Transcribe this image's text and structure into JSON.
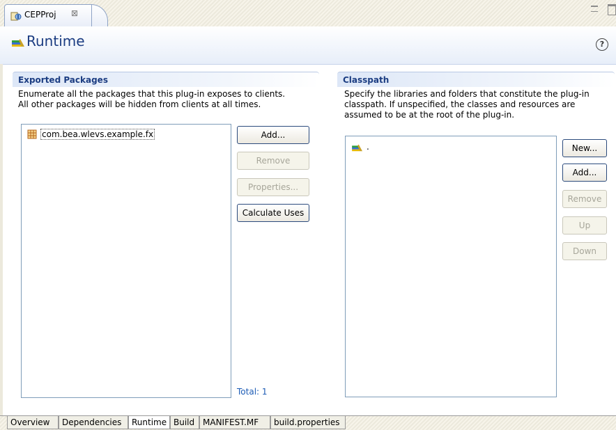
{
  "editor_tab": {
    "title": "CEPProj",
    "close_glyph": "⊠"
  },
  "header": {
    "title": "Runtime",
    "help_glyph": "?",
    "icon": "runtime-books-icon"
  },
  "exported_packages": {
    "title": "Exported Packages",
    "description_line1": "Enumerate all the packages that this plug-in exposes to clients.",
    "description_line2": "All other packages will be hidden from clients at all times.",
    "items": [
      "com.bea.wlevs.example.fx"
    ],
    "buttons": {
      "add": "Add...",
      "remove": "Remove",
      "properties": "Properties...",
      "calculate_uses": "Calculate Uses"
    },
    "total_label": "Total: 1"
  },
  "classpath": {
    "title": "Classpath",
    "description_line1": "Specify the libraries and folders that constitute the plug-in",
    "description_line2": "classpath.  If unspecified, the classes and resources are",
    "description_line3": "assumed to be at the root of the plug-in.",
    "items": [
      "."
    ],
    "buttons": {
      "new": "New...",
      "add": "Add...",
      "remove": "Remove",
      "up": "Up",
      "down": "Down"
    }
  },
  "page_tabs": [
    "Overview",
    "Dependencies",
    "Runtime",
    "Build",
    "MANIFEST.MF",
    "build.properties"
  ],
  "active_page_tab": "Runtime",
  "colors": {
    "title_blue": "#1c3d82",
    "link_blue": "#1c5bb5",
    "border_blue": "#7f9db9"
  }
}
